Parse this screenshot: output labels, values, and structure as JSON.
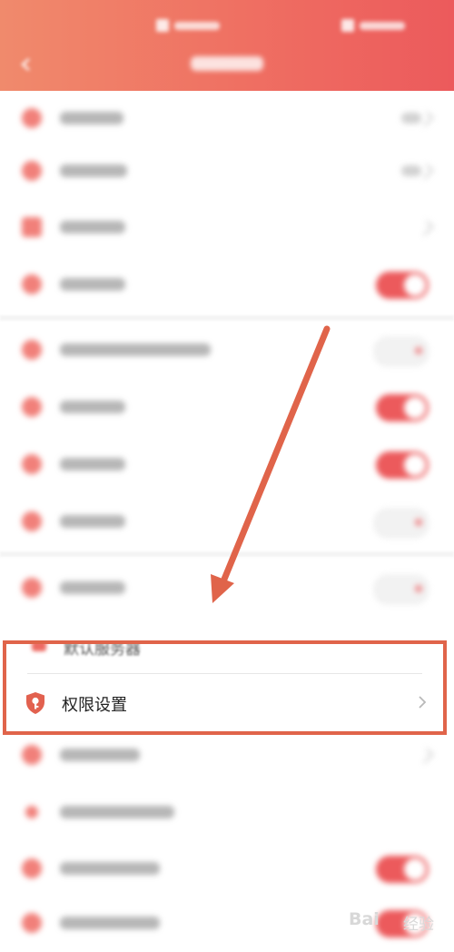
{
  "highlighted_row": {
    "partial_label": "默认服务器",
    "label": "权限设置",
    "icon": "shield-key-icon",
    "chevron": "chevron-right-icon"
  },
  "blurred_rows": [
    {
      "icon": "row-icon",
      "control": "value-chevron"
    },
    {
      "icon": "row-icon",
      "control": "value-chevron"
    },
    {
      "icon": "row-icon",
      "control": "chevron"
    },
    {
      "icon": "row-icon",
      "control": "toggle-on"
    },
    {
      "icon": "row-icon",
      "control": "toggle-off"
    },
    {
      "icon": "row-icon",
      "control": "toggle-on"
    },
    {
      "icon": "row-icon",
      "control": "toggle-on"
    },
    {
      "icon": "row-icon",
      "control": "toggle-off"
    },
    {
      "icon": "row-icon",
      "control": "toggle-off"
    },
    {
      "icon": "row-icon",
      "control": "chevron"
    },
    {
      "icon": "row-icon",
      "control": "none"
    },
    {
      "icon": "row-icon",
      "control": "toggle-on"
    },
    {
      "icon": "row-icon",
      "control": "toggle-on"
    }
  ],
  "watermark": {
    "logo": "Bai",
    "text": "经验"
  },
  "colors": {
    "header_start": "#f08a6c",
    "header_end": "#ec5a5c",
    "accent": "#ec5a5c",
    "annotation": "#e0644a"
  }
}
